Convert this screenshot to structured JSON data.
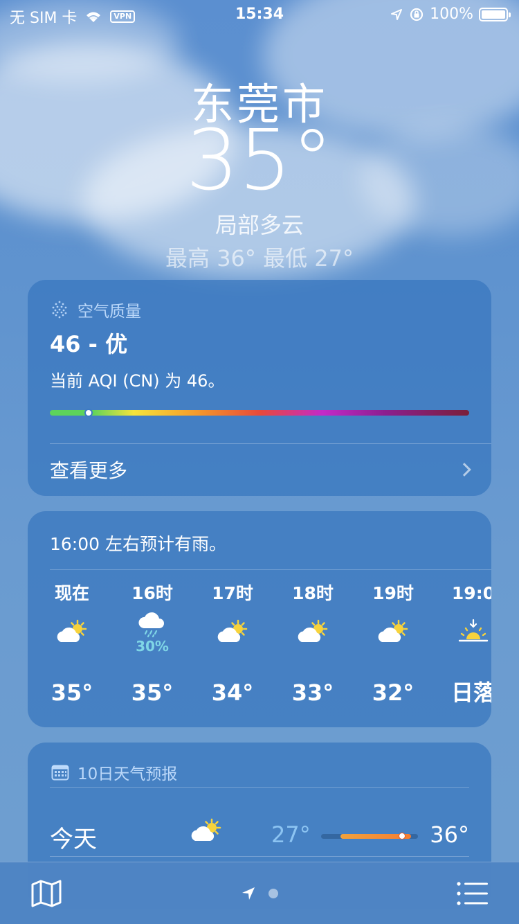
{
  "status_bar": {
    "carrier": "无 SIM 卡",
    "vpn": "VPN",
    "time": "15:34",
    "battery": "100%"
  },
  "header": {
    "city": "东莞市",
    "temperature": "35°",
    "condition": "局部多云",
    "high_low": "最高 36°  最低 27°"
  },
  "air_quality": {
    "title": "空气质量",
    "value": "46 - 优",
    "description": "当前 AQI (CN) 为 46。",
    "aqi": 46,
    "see_more": "查看更多",
    "bar_colors": [
      "#5dd35b",
      "#f5e43b",
      "#f59a2b",
      "#e64a3a",
      "#c22ac8",
      "#7a1f3a"
    ]
  },
  "hourly": {
    "note": "16:00 左右预计有雨。",
    "items": [
      {
        "label": "现在",
        "icon": "partly-sunny-icon",
        "prob": "",
        "temp": "35°"
      },
      {
        "label": "16时",
        "icon": "rain-cloud-icon",
        "prob": "30%",
        "temp": "35°"
      },
      {
        "label": "17时",
        "icon": "partly-sunny-icon",
        "prob": "",
        "temp": "34°"
      },
      {
        "label": "18时",
        "icon": "partly-sunny-icon",
        "prob": "",
        "temp": "33°"
      },
      {
        "label": "19时",
        "icon": "partly-sunny-icon",
        "prob": "",
        "temp": "32°"
      },
      {
        "label": "19:0",
        "icon": "sunset-icon",
        "prob": "",
        "temp": "日落"
      }
    ]
  },
  "forecast": {
    "title": "10日天气预报",
    "days": [
      {
        "name": "今天",
        "icon": "partly-sunny-icon",
        "low": "27°",
        "high": "36°",
        "current": 35
      }
    ]
  },
  "colors": {
    "accent": "#8cc4f2",
    "rain_prob": "#7fd6e6"
  }
}
